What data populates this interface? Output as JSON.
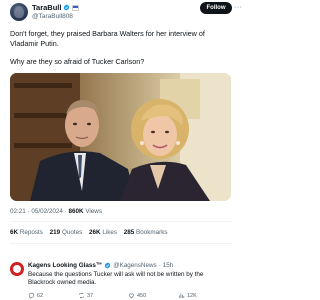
{
  "author": {
    "display_name": "TaraBull",
    "handle": "@TaraBull808",
    "follow_label": "Follow"
  },
  "tweet": {
    "paragraphs": [
      "Don't forget, they praised Barbara Walters for her interview of Vladamir Putin.",
      "Why are they so afraid of Tucker Carlson?"
    ]
  },
  "meta": {
    "time": "02:21",
    "date": "05/02/2024",
    "views_count": "860K",
    "views_label": "Views"
  },
  "stats": [
    {
      "count": "6K",
      "label": "Reposts"
    },
    {
      "count": "219",
      "label": "Quotes"
    },
    {
      "count": "26K",
      "label": "Likes"
    },
    {
      "count": "285",
      "label": "Bookmarks"
    }
  ],
  "reply": {
    "display_name": "Kagens Looking Glass™",
    "handle": "@KagensNews",
    "age": "15h",
    "text": "Because the questions Tucker will ask will not be written by the Blackrock owned media.",
    "actions": {
      "replies": "62",
      "reposts": "37",
      "likes": "450",
      "views": "12K"
    }
  },
  "colors": {
    "verified_blue": "#1d9bf0",
    "text": "#0f1419",
    "secondary": "#536471",
    "follow_bg": "#0f1419",
    "reply_avatar": "#d21f1f"
  },
  "icons": [
    "verified-badge-icon",
    "flag-icon",
    "more-icon",
    "reply-icon",
    "repost-icon",
    "like-icon",
    "views-icon"
  ]
}
